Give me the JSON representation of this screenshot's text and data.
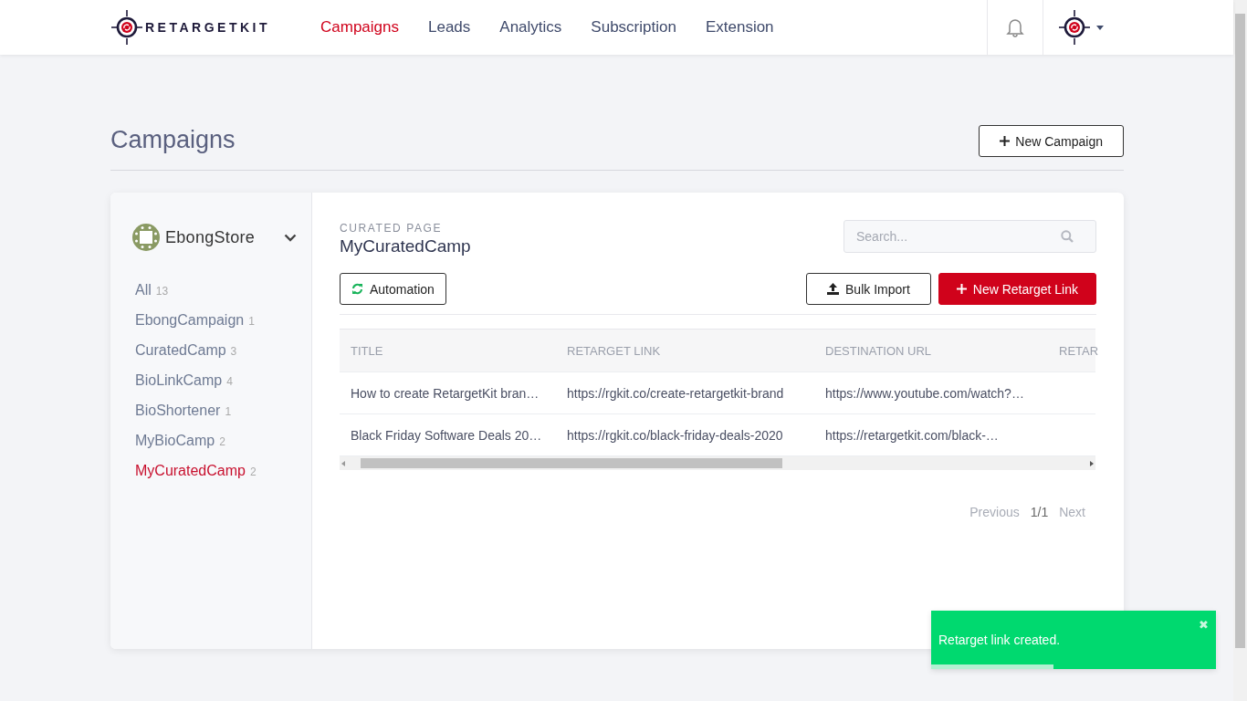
{
  "header": {
    "logo": "RETARGETKIT",
    "nav": [
      {
        "label": "Campaigns",
        "selected": true
      },
      {
        "label": "Leads",
        "selected": false
      },
      {
        "label": "Analytics",
        "selected": false
      },
      {
        "label": "Subscription",
        "selected": false
      },
      {
        "label": "Extension",
        "selected": false
      }
    ]
  },
  "page": {
    "title": "Campaigns",
    "new_button": "New Campaign"
  },
  "sidebar": {
    "store": "EbongStore",
    "items": [
      {
        "label": "All",
        "count": "13",
        "selected": false
      },
      {
        "label": "EbongCampaign",
        "count": "1",
        "selected": false
      },
      {
        "label": "CuratedCamp",
        "count": "3",
        "selected": false
      },
      {
        "label": "BioLinkCamp",
        "count": "4",
        "selected": false
      },
      {
        "label": "BioShortener",
        "count": "1",
        "selected": false
      },
      {
        "label": "MyBioCamp",
        "count": "2",
        "selected": false
      },
      {
        "label": "MyCuratedCamp",
        "count": "2",
        "selected": true
      }
    ]
  },
  "panel": {
    "kicker": "CURATED PAGE",
    "title": "MyCuratedCamp",
    "search": {
      "placeholder": "Search..."
    },
    "buttons": [
      {
        "kind": "automation",
        "label": "Automation"
      },
      {
        "kind": "import",
        "label": "Bulk Import"
      },
      {
        "kind": "create",
        "label": "New Retarget Link"
      }
    ],
    "table": {
      "columns": [
        "TITLE",
        "RETARGET LINK",
        "DESTINATION URL",
        "RETAR"
      ],
      "rows": [
        [
          "How to create RetargetKit bran…",
          "https://rgkit.co/create-retargetkit-brand",
          "https://www.youtube.com/watch?…"
        ],
        [
          "Black Friday Software Deals 20…",
          "https://rgkit.co/black-friday-deals-2020",
          "https://retargetkit.com/black-…"
        ]
      ]
    },
    "pagination": {
      "previous": "Previous",
      "current": "1/1",
      "next": "Next"
    }
  },
  "toast": {
    "message": "Retarget link created.",
    "close": "✖",
    "level": 0.43
  }
}
